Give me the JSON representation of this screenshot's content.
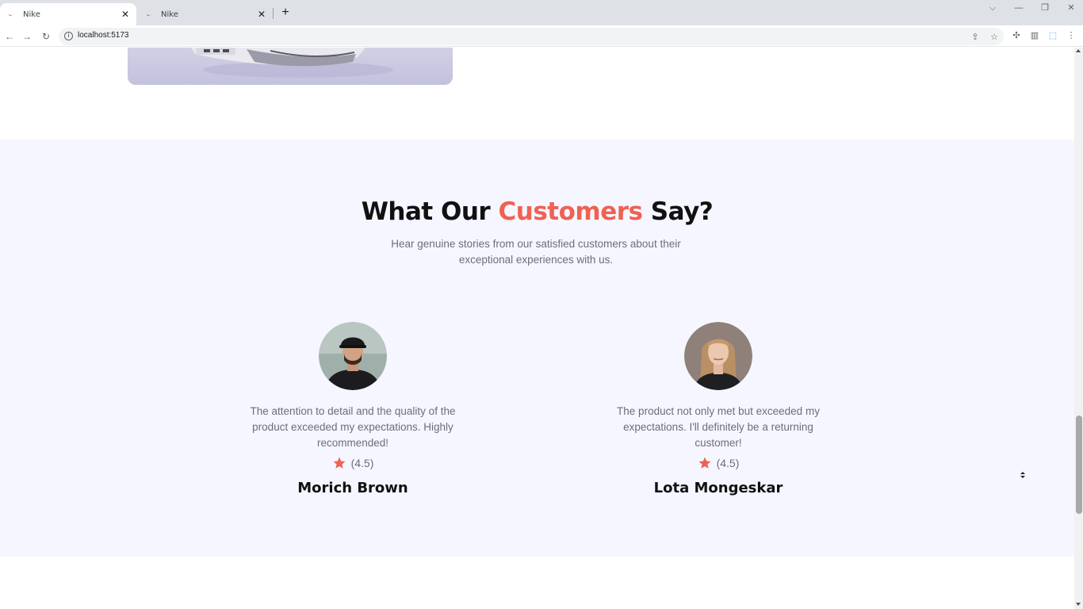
{
  "browser": {
    "tabs": [
      {
        "title": "Nike",
        "close": "✕"
      },
      {
        "title": "Nike",
        "close": "✕"
      }
    ],
    "new_tab": "+",
    "window_controls": {
      "tabs_menu": "⌵",
      "minimize": "—",
      "maximize": "❐",
      "close": "✕"
    },
    "nav": {
      "back": "←",
      "forward": "→",
      "reload": "↻"
    },
    "url": "localhost:5173",
    "icons": {
      "info": "i",
      "share": "⇪",
      "bookmark": "☆",
      "extensions": "✣",
      "sidepanel": "▥",
      "profile": "⬚",
      "menu": "⋮"
    }
  },
  "page": {
    "reviews": {
      "title_before": "What Our ",
      "title_accent": "Customers",
      "title_after": " Say?",
      "subtitle": "Hear genuine stories from our satisfied customers about their exceptional experiences with us.",
      "items": [
        {
          "quote": "The attention to detail and the quality of the product exceeded my expectations. Highly recommended!",
          "rating": "(4.5)",
          "name": "Morich Brown"
        },
        {
          "quote": "The product not only met but exceeded my expectations. I'll definitely be a returning customer!",
          "rating": "(4.5)",
          "name": "Lota Mongeskar"
        }
      ]
    }
  },
  "colors": {
    "accent": "#ef6152",
    "section_bg": "#f5f6ff",
    "heading": "#111111",
    "body_text": "#6d6d78"
  }
}
